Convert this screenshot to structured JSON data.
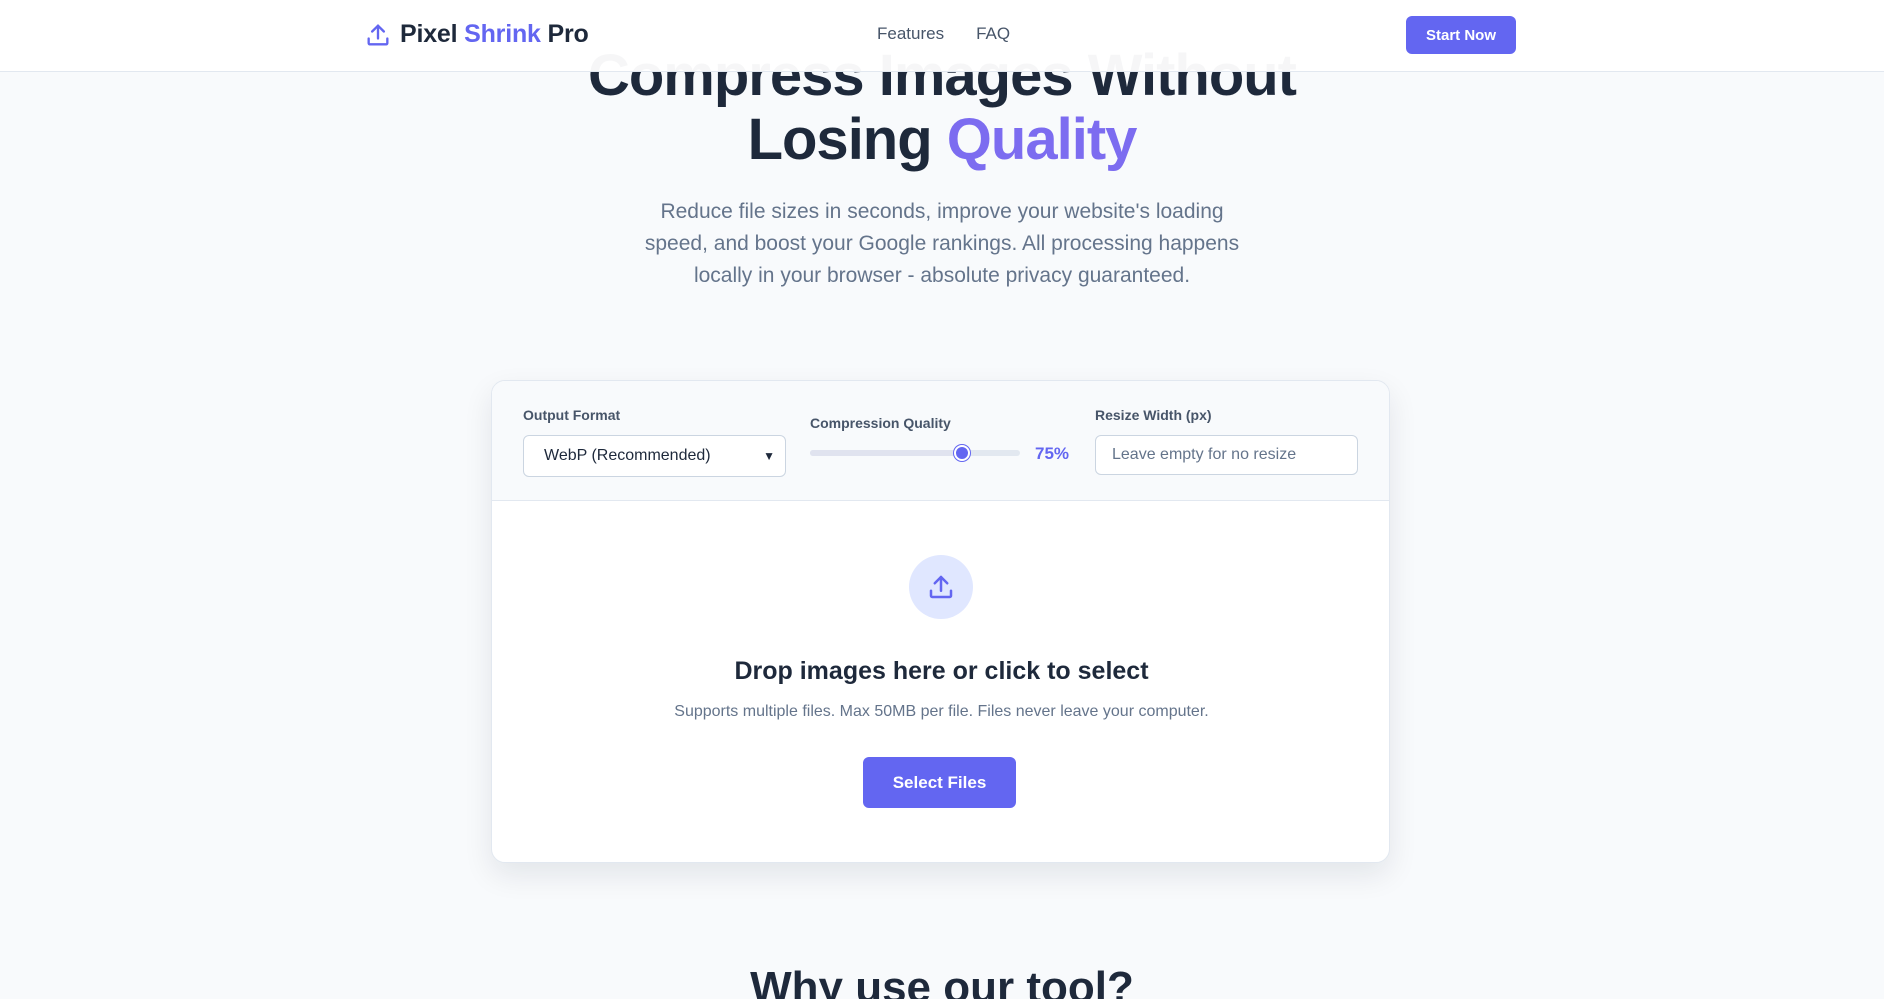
{
  "header": {
    "logo": {
      "part1": "Pixel",
      "part2": "Shrink",
      "part3": "Pro"
    },
    "nav": [
      {
        "label": "Features"
      },
      {
        "label": "FAQ"
      }
    ],
    "cta_label": "Start Now"
  },
  "hero": {
    "title_line1": "Compress Images Without",
    "title_line2_plain": "Losing",
    "title_line2_accent": "Quality",
    "subtitle": "Reduce file sizes in seconds, improve your website's loading speed, and boost your Google rankings. All processing happens locally in your browser - absolute privacy guaranteed."
  },
  "settings": {
    "output_format": {
      "label": "Output Format",
      "selected": "WebP (Recommended)"
    },
    "compression": {
      "label": "Compression Quality",
      "value": 75,
      "display": "75%"
    },
    "resize": {
      "label": "Resize Width (px)",
      "placeholder": "Leave empty for no resize",
      "value": ""
    }
  },
  "dropzone": {
    "icon": "upload-icon",
    "title": "Drop images here or click to select",
    "subtitle": "Supports multiple files. Max 50MB per file. Files never leave your computer.",
    "button_label": "Select Files"
  },
  "section": {
    "why_title": "Why use our tool?"
  },
  "colors": {
    "accent": "#6366f1",
    "text": "#1e293b",
    "muted": "#64748b",
    "background": "#f8fafc"
  }
}
